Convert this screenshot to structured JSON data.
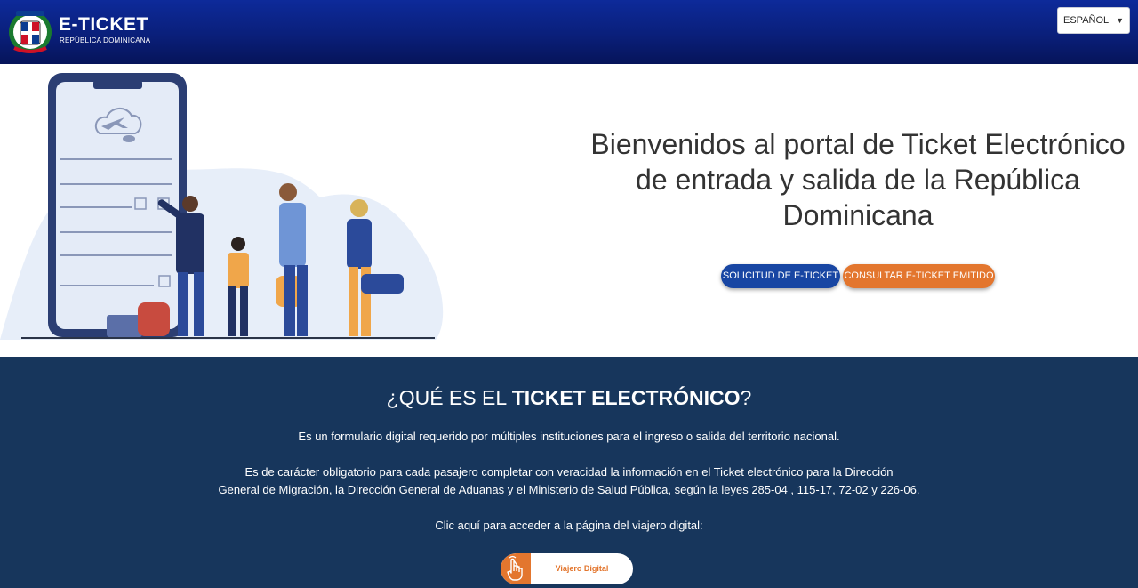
{
  "header": {
    "brand_title": "E-TICKET",
    "brand_subtitle": "REPÚBLICA DOMINICANA",
    "language": "ESPAÑOL",
    "logo_icon": "dominican-republic-coat-of-arms-icon"
  },
  "hero": {
    "heading": "Bienvenidos al portal de Ticket Electrónico de entrada y salida de la República Dominicana",
    "btn_solicitud": "SOLICITUD DE E-TICKET",
    "btn_consultar": "CONSULTAR E-TICKET EMITIDO"
  },
  "info": {
    "title_prefix": "¿QUÉ ES EL ",
    "title_bold": "TICKET ELECTRÓNICO",
    "title_suffix": "?",
    "p1": "Es un formulario digital requerido por múltiples instituciones para el ingreso o salida del territorio nacional.",
    "p2_line1": "Es de carácter obligatorio para cada pasajero completar con veracidad la información en el Ticket electrónico para la Dirección",
    "p2_line2": "General de Migración, la Dirección General de Aduanas y el Ministerio de Salud Pública, según la leyes 285-04 , 115-17, 72-02 y 226-06.",
    "p3": "Clic aquí para acceder a la página del viajero digital:",
    "viajero_btn": "Viajero Digital",
    "viajero_icon": "pointing-hand-icon"
  },
  "colors": {
    "header_blue": "#0a1f7a",
    "primary_button": "#1846a3",
    "accent_orange": "#e3762e",
    "section_navy": "#17365c"
  }
}
